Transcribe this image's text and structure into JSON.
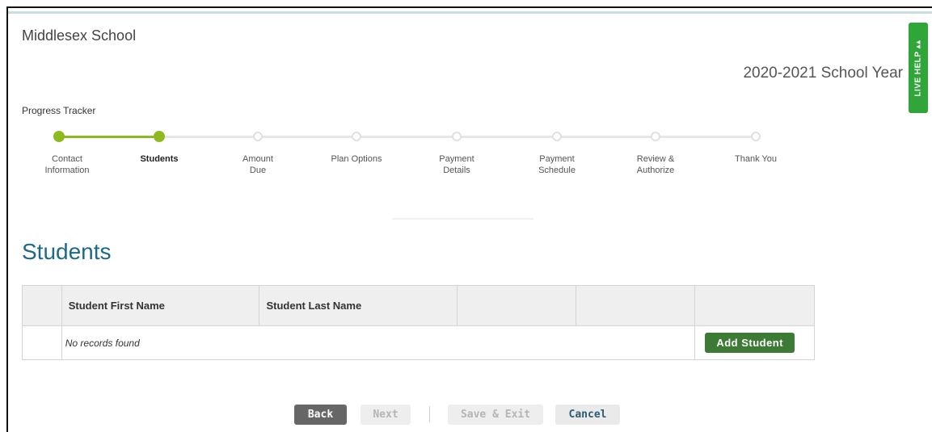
{
  "header": {
    "school_name": "Middlesex School",
    "school_year": "2020-2021 School Year",
    "live_help": "LIVE HELP",
    "live_help_icon": "arrows-icon"
  },
  "tracker": {
    "title": "Progress Tracker",
    "steps": [
      {
        "label": "Contact\nInformation",
        "status": "done"
      },
      {
        "label": "Students",
        "status": "current"
      },
      {
        "label": "Amount\nDue",
        "status": "todo"
      },
      {
        "label": "Plan Options",
        "status": "todo"
      },
      {
        "label": "Payment\nDetails",
        "status": "todo"
      },
      {
        "label": "Payment\nSchedule",
        "status": "todo"
      },
      {
        "label": "Review &\nAuthorize",
        "status": "todo"
      },
      {
        "label": "Thank You",
        "status": "todo"
      }
    ]
  },
  "main": {
    "title": "Students",
    "table": {
      "columns": [
        "",
        "Student First Name",
        "Student Last Name",
        "",
        "",
        ""
      ],
      "empty_text": "No records found",
      "add_label": "Add Student"
    }
  },
  "footer": {
    "back": "Back",
    "next": "Next",
    "save_exit": "Save & Exit",
    "cancel": "Cancel"
  },
  "colors": {
    "accent_green": "#8dba1f",
    "title_blue": "#1e6a86",
    "add_button": "#3c7a36",
    "live_help": "#2fa53a"
  }
}
